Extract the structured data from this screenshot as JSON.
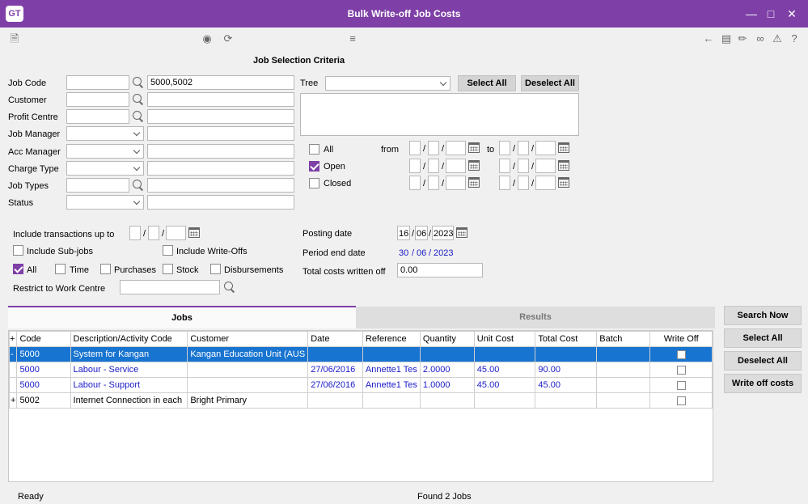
{
  "window": {
    "logo": "GT",
    "title": "Bulk Write-off Job Costs"
  },
  "criteria": {
    "heading": "Job Selection Criteria",
    "job_code_label": "Job Code",
    "job_code_value": "5000,5002",
    "customer_label": "Customer",
    "profit_centre_label": "Profit Centre",
    "job_manager_label": "Job Manager",
    "acc_manager_label": "Acc Manager",
    "charge_type_label": "Charge Type",
    "job_types_label": "Job Types",
    "status_label": "Status",
    "tree_label": "Tree",
    "select_all": "Select All",
    "deselect_all": "Deselect All",
    "all_label": "All",
    "open_label": "Open",
    "closed_label": "Closed",
    "from_label": "from",
    "to_label": "to"
  },
  "options": {
    "include_up_to_label": "Include transactions up to",
    "include_subjobs_label": "Include Sub-jobs",
    "include_writeoffs_label": "Include Write-Offs",
    "all_label": "All",
    "time_label": "Time",
    "purchases_label": "Purchases",
    "stock_label": "Stock",
    "disbursements_label": "Disbursements",
    "restrict_label": "Restrict to Work Centre",
    "posting_date_label": "Posting date",
    "posting_day": "16",
    "posting_month": "06",
    "posting_year": "2023",
    "period_end_label": "Period end date",
    "period_day": "30",
    "period_month": "06",
    "period_year": "2023",
    "total_costs_label": "Total costs written off",
    "total_costs_value": "0.00"
  },
  "tabs": {
    "jobs": "Jobs",
    "results": "Results"
  },
  "actions": {
    "search_now": "Search Now",
    "select_all": "Select All",
    "deselect_all": "Deselect All",
    "write_off": "Write off costs"
  },
  "grid": {
    "headers": {
      "expand": "+",
      "code": "Code",
      "description": "Description/Activity Code",
      "customer": "Customer",
      "date": "Date",
      "reference": "Reference",
      "quantity": "Quantity",
      "unit_cost": "Unit Cost",
      "total_cost": "Total Cost",
      "batch": "Batch",
      "write_off": "Write Off"
    },
    "rows": [
      {
        "expand": "-",
        "code": "5000",
        "description": "System for Kangan",
        "customer": "Kangan Education Unit (AUS",
        "date": "",
        "reference": "",
        "quantity": "",
        "unit_cost": "",
        "total_cost": "",
        "batch": ""
      },
      {
        "expand": "",
        "code": "5000",
        "description": "Labour - Service",
        "customer": "",
        "date": "27/06/2016",
        "reference": "Annette1 Tes",
        "quantity": "2.0000",
        "unit_cost": "45.00",
        "total_cost": "90.00",
        "batch": ""
      },
      {
        "expand": "",
        "code": "5000",
        "description": "Labour - Support",
        "customer": "",
        "date": "27/06/2016",
        "reference": "Annette1 Tes",
        "quantity": "1.0000",
        "unit_cost": "45.00",
        "total_cost": "45.00",
        "batch": ""
      },
      {
        "expand": "+",
        "code": "5002",
        "description": "Internet Connection in each",
        "customer": "Bright Primary",
        "date": "",
        "reference": "",
        "quantity": "",
        "unit_cost": "",
        "total_cost": "",
        "batch": ""
      }
    ]
  },
  "status": {
    "left": "Ready",
    "middle": "Found 2 Jobs"
  }
}
